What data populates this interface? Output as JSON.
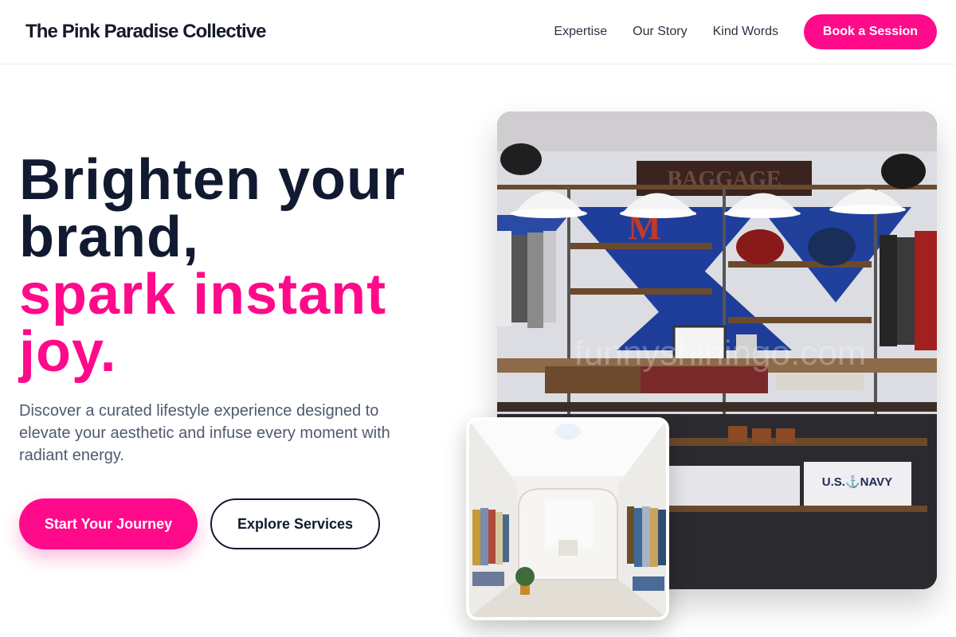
{
  "header": {
    "logo": "The Pink Paradise Collective",
    "nav": [
      {
        "label": "Expertise"
      },
      {
        "label": "Our Story"
      },
      {
        "label": "Kind Words"
      }
    ],
    "cta_label": "Book a Session"
  },
  "hero": {
    "headline_line1": "Brighten your",
    "headline_line2": "brand,",
    "headline_pink1": "spark instant",
    "headline_pink2": "joy.",
    "subtext": "Discover a curated lifestyle experience designed to elevate your aesthetic and infuse every moment with radiant energy.",
    "primary_cta": "Start Your Journey",
    "secondary_cta": "Explore Services"
  },
  "images": {
    "main_watermark": "funnyshiningo.com",
    "main_sign_text": "BAGGAGE",
    "main_letter": "M",
    "main_shirt_text": "U.S.⚓NAVY"
  },
  "colors": {
    "accent": "#ff0a8a",
    "text_dark": "#111a30",
    "text_muted": "#4f5a6e"
  }
}
